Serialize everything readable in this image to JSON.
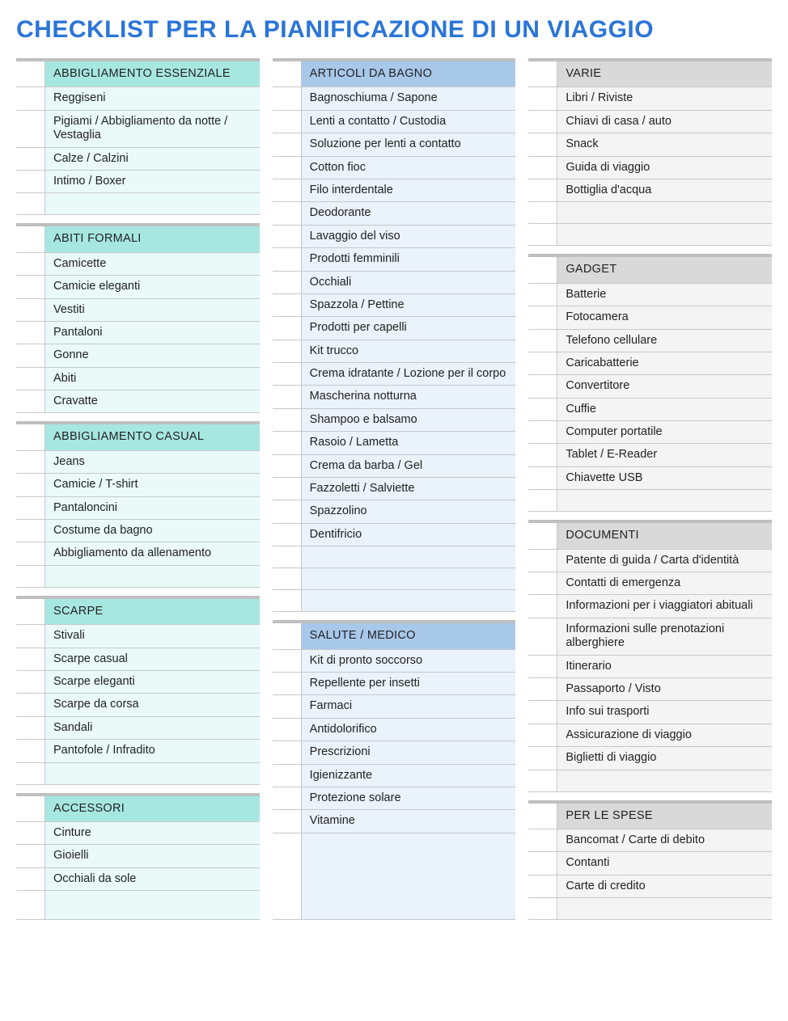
{
  "title": "CHECKLIST PER LA PIANIFICAZIONE DI UN VIAGGIO",
  "columns": [
    {
      "color": "teal",
      "sections": [
        {
          "header": "ABBIGLIAMENTO ESSENZIALE",
          "items": [
            "Reggiseni",
            "Pigiami / Abbigliamento da notte / Vestaglia",
            "Calze / Calzini",
            "Intimo / Boxer",
            ""
          ]
        },
        {
          "header": "ABITI FORMALI",
          "items": [
            "Camicette",
            "Camicie eleganti",
            "Vestiti",
            "Pantaloni",
            "Gonne",
            "Abiti",
            "Cravatte"
          ]
        },
        {
          "header": "ABBIGLIAMENTO CASUAL",
          "items": [
            "Jeans",
            "Camicie / T-shirt",
            "Pantaloncini",
            "Costume da bagno",
            "Abbigliamento da allenamento",
            ""
          ]
        },
        {
          "header": "SCARPE",
          "items": [
            "Stivali",
            "Scarpe casual",
            "Scarpe eleganti",
            "Scarpe da corsa",
            "Sandali",
            "Pantofole / Infradito",
            ""
          ]
        },
        {
          "header": "ACCESSORI",
          "items": [
            "Cinture",
            "Gioielli",
            "Occhiali da sole"
          ],
          "filler": true
        }
      ]
    },
    {
      "color": "blue",
      "sections": [
        {
          "header": "ARTICOLI DA BAGNO",
          "items": [
            "Bagnoschiuma / Sapone",
            "Lenti a contatto / Custodia",
            "Soluzione per lenti a contatto",
            "Cotton fioc",
            "Filo interdentale",
            "Deodorante",
            "Lavaggio del viso",
            "Prodotti femminili",
            "Occhiali",
            "Spazzola / Pettine",
            "Prodotti per capelli",
            "Kit trucco",
            "Crema idratante / Lozione per il corpo",
            "Mascherina notturna",
            "Shampoo e balsamo",
            "Rasoio / Lametta",
            "Crema da barba / Gel",
            "Fazzoletti / Salviette",
            "Spazzolino",
            "Dentifricio",
            "",
            "",
            ""
          ]
        },
        {
          "header": "SALUTE / MEDICO",
          "items": [
            "Kit di pronto soccorso",
            "Repellente per insetti",
            "Farmaci",
            "Antidolorifico",
            "Prescrizioni",
            "Igienizzante",
            "Protezione solare",
            "Vitamine"
          ],
          "filler": true
        }
      ]
    },
    {
      "color": "gray",
      "sections": [
        {
          "header": "VARIE",
          "items": [
            "Libri / Riviste",
            "Chiavi di casa / auto",
            "Snack",
            "Guida di viaggio",
            "Bottiglia d'acqua",
            "",
            ""
          ]
        },
        {
          "header": "GADGET",
          "items": [
            "Batterie",
            "Fotocamera",
            "Telefono cellulare",
            "Caricabatterie",
            "Convertitore",
            "Cuffie",
            "Computer portatile",
            "Tablet / E-Reader",
            "Chiavette USB",
            ""
          ]
        },
        {
          "header": "DOCUMENTI",
          "items": [
            "Patente di guida / Carta d'identità",
            "Contatti di emergenza",
            "Informazioni per i viaggiatori abituali",
            "Informazioni sulle prenotazioni alberghiere",
            "Itinerario",
            "Passaporto / Visto",
            "Info sui trasporti",
            "Assicurazione di viaggio",
            "Biglietti di viaggio",
            ""
          ]
        },
        {
          "header": "PER LE SPESE",
          "items": [
            "Bancomat / Carte di debito",
            "Contanti",
            "Carte di credito"
          ],
          "filler": true
        }
      ]
    }
  ]
}
